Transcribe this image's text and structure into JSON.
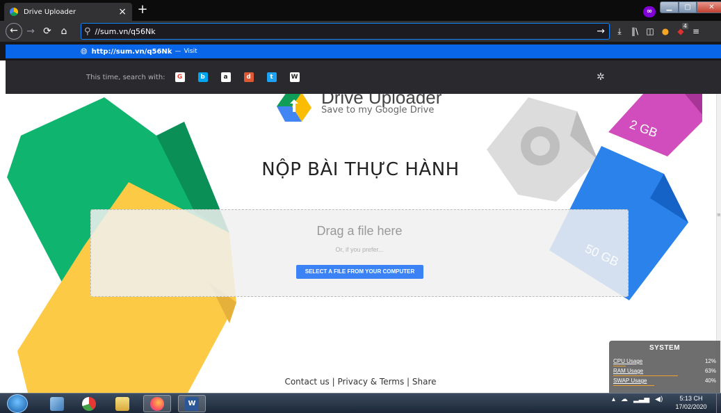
{
  "browser": {
    "tab_title": "Drive Uploader",
    "tab_close": "×",
    "new_tab": "+",
    "private_badge": "∞",
    "url_value": "//sum.vn/q56Nk",
    "go_arrow": "→",
    "download_count": "4",
    "suggestion": {
      "url": "http://sum.vn/q56Nk",
      "separator": "—",
      "action": "Visit"
    },
    "search_with_label": "This time, search with:",
    "search_engines": [
      {
        "name": "google",
        "glyph": "G",
        "color": "#ffffff",
        "fg": "#ea4335"
      },
      {
        "name": "bing",
        "glyph": "b",
        "color": "#00a4ef",
        "fg": "#ffffff"
      },
      {
        "name": "amazon",
        "glyph": "a",
        "color": "#ffffff",
        "fg": "#222222"
      },
      {
        "name": "duckduckgo",
        "glyph": "d",
        "color": "#de5833",
        "fg": "#ffffff"
      },
      {
        "name": "twitter",
        "glyph": "t",
        "color": "#1da1f2",
        "fg": "#ffffff"
      },
      {
        "name": "wikipedia",
        "glyph": "W",
        "color": "#ffffff",
        "fg": "#222222"
      }
    ]
  },
  "page": {
    "logo_title": "Drive Uploader",
    "logo_subtitle": "Save to my Google Drive",
    "heading": "NỘP BÀI THỰC HÀNH",
    "dropzone_title": "Drag a file here",
    "dropzone_sub": "Or, if you prefer...",
    "select_button": "SELECT A FILE FROM YOUR COMPUTER",
    "footer": "Contact us | Privacy & Terms | Share",
    "illustration_2gb": "2 GB",
    "illustration_50gb": "50 GB"
  },
  "system_widget": {
    "title": "SYSTEM",
    "rows": [
      {
        "name": "CPU Usage",
        "value": "12%",
        "fraction": 0.12
      },
      {
        "name": "RAM Usage",
        "value": "63%",
        "fraction": 0.63
      },
      {
        "name": "SWAP Usage",
        "value": "40%",
        "fraction": 0.4
      }
    ]
  },
  "taskbar": {
    "time": "5:13 CH",
    "date": "17/02/2020"
  },
  "colors": {
    "accent": "#0a84ff",
    "select_button": "#3b82f6",
    "green_doc": "#0fb56f",
    "yellow_doc": "#fdca45",
    "blue_doc": "#2a82ea",
    "pink_doc": "#d14dbd"
  }
}
